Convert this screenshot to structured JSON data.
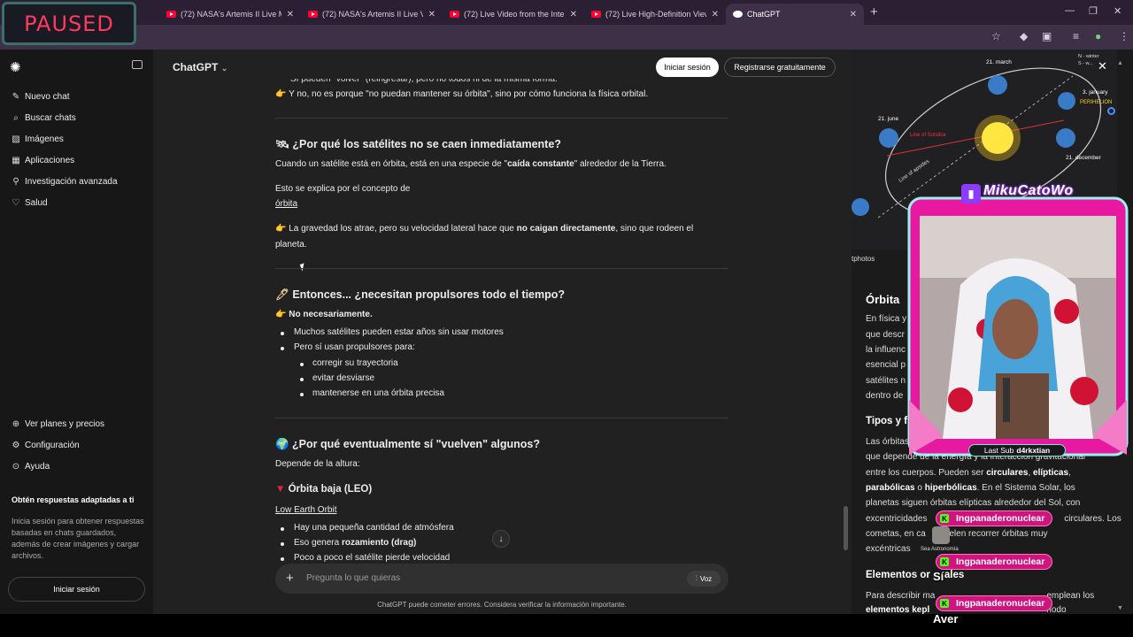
{
  "browser": {
    "tabs": [
      {
        "title": "(72) NASA's Artemis II Live Mis..."
      },
      {
        "title": "(72) NASA's Artemis II Live Vie..."
      },
      {
        "title": "(72) Live Video from the Interna..."
      },
      {
        "title": "(72) Live High-Definition Views..."
      },
      {
        "title": "ChatGPT"
      }
    ],
    "new_tab": "+"
  },
  "stream": {
    "paused_label": "PAUSED",
    "streamer_name": "MikuCatoWo",
    "last_sub_label": "Last Sub",
    "last_sub_user": "d4rkxtian",
    "chat": [
      {
        "user": "Ingpanaderonuclear",
        "message": ""
      },
      {
        "user": "Ingpanaderonuclear",
        "message": "Sí"
      },
      {
        "user": "Ingpanaderonuclear",
        "message": "Aver"
      }
    ],
    "avatar_caption": "Sea Astronomía"
  },
  "sidebar": {
    "items": [
      {
        "icon": "edit-icon",
        "label": "Nuevo chat"
      },
      {
        "icon": "search-icon",
        "label": "Buscar chats"
      },
      {
        "icon": "image-icon",
        "label": "Imágenes"
      },
      {
        "icon": "apps-icon",
        "label": "Aplicaciones"
      },
      {
        "icon": "research-icon",
        "label": "Investigación avanzada"
      },
      {
        "icon": "heart-icon",
        "label": "Salud"
      }
    ],
    "bottom_items": [
      {
        "icon": "plans-icon",
        "label": "Ver planes y precios"
      },
      {
        "icon": "gear-icon",
        "label": "Configuración"
      },
      {
        "icon": "help-icon",
        "label": "Ayuda"
      }
    ],
    "promo_title": "Obtén respuestas adaptadas a ti",
    "promo_body": "Inicia sesión para obtener respuestas basadas en chats guardados, además de crear imágenes y cargar archivos.",
    "login_button": "Iniciar sesión"
  },
  "header": {
    "model": "ChatGPT",
    "login_button": "Iniciar sesión",
    "register_button": "Registrarse gratuitamente"
  },
  "content": {
    "top_line_partial": "Sí pueden \"volver\" (reingresar), pero no todos ni de la misma forma.",
    "top_line": "Y no, no es porque \"no puedan mantener su órbita\", sino por cómo funciona la física orbital.",
    "s1_heading": "¿Por qué los satélites no se caen inmediatamente?",
    "s1_p1_pre": "Cuando un satélite está en órbita, está en una especie de \"",
    "s1_p1_bold": "caída constante",
    "s1_p1_post": "\" alrededor de la Tierra.",
    "s1_p2": "Esto se explica por el concepto de",
    "s1_link": "órbita",
    "s1_p3_pre": "La gravedad los atrae, pero su velocidad lateral hace que ",
    "s1_p3_bold": "no caigan directamente",
    "s1_p3_post": ", sino que rodeen el",
    "s1_p3_cont": "planeta.",
    "s2_heading": "Entonces... ¿necesitan propulsores todo el tiempo?",
    "s2_answer": "No necesariamente.",
    "s2_bullets": [
      "Muchos satélites pueden estar años sin usar motores",
      "Pero sí usan propulsores para:"
    ],
    "s2_subbullets": [
      "corregir su trayectoria",
      "evitar desviarse",
      "mantenerse en una órbita precisa"
    ],
    "s3_heading": "¿Por qué eventualmente sí \"vuelven\" algunos?",
    "s3_p1": "Depende de la altura:",
    "s3_sub_heading": "Órbita baja (LEO)",
    "s3_link": "Low Earth Orbit",
    "s3_bullets": [
      "Hay una pequeña cantidad de atmósfera",
      "Eso genera ",
      "Poco a poco el satélite pierde velocidad"
    ],
    "s3_bullet2_bold": "rozamiento (drag)"
  },
  "composer": {
    "placeholder": "Pregunta lo que quieras",
    "voice_label": "Voz",
    "disclaimer": "ChatGPT puede cometer errores. Considera verificar la información importante."
  },
  "right_panel": {
    "diagram_labels": {
      "march": "21. march",
      "june": "21. june",
      "december": "21. december",
      "january": "3. january",
      "perihelion": "PERIHELION",
      "solstice": "Line of Solstice",
      "apsides": "Line of apsides",
      "winter": "N - winter",
      "s_w": "S - w..."
    },
    "photos_caption": "tphotos",
    "title": "Órbita",
    "intro_lines": [
      "En física y",
      "que descr",
      "la influenc",
      "esencial p",
      "satélites n",
      "dentro de"
    ],
    "h_types": "Tipos y f",
    "types_line1": "Las órbitas pueden clasificarse por su forma geométrica,",
    "types_line2": "que depende de la energía y la interacción gravitacional",
    "types_line3": "entre los cuerpos. Pueden ser ",
    "types_circ": "circulares",
    "types_ell": "elípticas",
    "types_par": "parabólicas",
    "types_or": " o ",
    "types_hyp": "hiperbólicas",
    "types_line4_post": ". En el Sistema Solar, los",
    "types_line5": "planetas siguen órbitas elípticas alrededor del Sol, con",
    "types_line6": "excentricidades ",
    "types_line6_post": "circulares. Los",
    "types_line7": "cometas, en ca",
    "types_line7_post": "suelen recorrer órbitas muy",
    "types_line8": "excéntricas",
    "h_elements": "Elementos or",
    "h_elements_post": "ales",
    "el_line1": "Para describir ma",
    "el_line1_post": "emplean los",
    "el_line2": "elementos kepl",
    "el_line2_post": "nodo"
  },
  "colors": {
    "sidebar_bg": "#171717",
    "main_bg": "#212121",
    "tabstrip_bg": "#2b1f33",
    "chat_pink": "#d0147f",
    "kick_green": "#53fc18"
  }
}
